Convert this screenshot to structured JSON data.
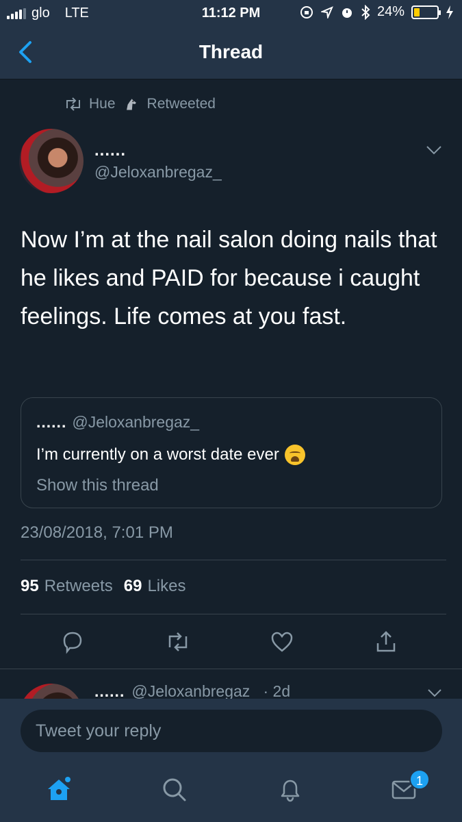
{
  "status_bar": {
    "carrier": "glo",
    "network": "LTE",
    "time": "11:12 PM",
    "battery_percent": "24%",
    "battery_level": 0.24
  },
  "nav": {
    "back_icon": "chevron-left-icon",
    "title": "Thread"
  },
  "retweet_context": {
    "user": "Hue",
    "label": "Retweeted"
  },
  "tweet": {
    "author_name": "......",
    "author_handle": "@Jeloxanbregaz_",
    "text": "Now I’m at the nail salon doing nails that he likes and PAID for because i caught feelings. Life comes at you fast.",
    "quoted": {
      "author_name": "......",
      "author_handle": "@Jeloxanbregaz_",
      "text": "I’m currently on a worst date ever",
      "show_thread": "Show this thread"
    },
    "timestamp": "23/08/2018, 7:01 PM",
    "retweets_count": "95",
    "retweets_label": "Retweets",
    "likes_count": "69",
    "likes_label": "Likes"
  },
  "next_tweet": {
    "author_name": "......",
    "handle_time": "@Jeloxanbregaz_ · 2d"
  },
  "composer": {
    "placeholder": "Tweet your reply"
  },
  "tabbar": {
    "messages_badge": "1"
  },
  "colors": {
    "background": "#15202b",
    "header": "#243447",
    "accent": "#1da1f2",
    "muted": "#8899a6"
  }
}
